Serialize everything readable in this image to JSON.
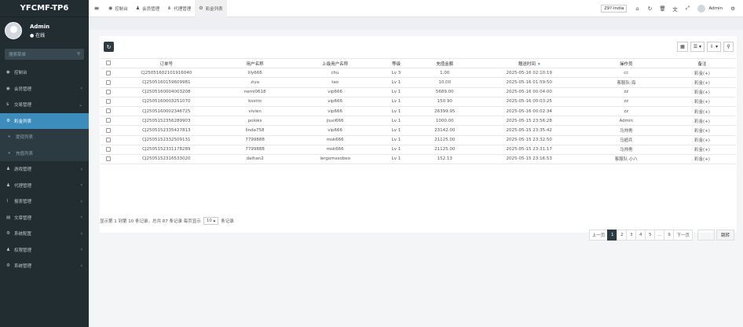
{
  "app": {
    "logo": "YFCMF-TP6"
  },
  "user": {
    "name": "Admin",
    "status": "● 在线"
  },
  "sidebar": {
    "search_placeholder": "搜索菜单",
    "items": [
      {
        "icon": "dashboard-icon",
        "glyph": "◉",
        "label": "控制台",
        "caret": false,
        "state": ""
      },
      {
        "icon": "users-icon",
        "glyph": "◉",
        "label": "会员管理",
        "caret": true,
        "state": ""
      },
      {
        "icon": "dollar-icon",
        "glyph": "$",
        "label": "交易管理",
        "caret": true,
        "state": "open"
      },
      {
        "icon": "gear-icon",
        "glyph": "⚙",
        "label": "彩金列表",
        "caret": false,
        "state": "active"
      },
      {
        "icon": "minus-icon",
        "glyph": "»",
        "label": "提现列表",
        "caret": false,
        "state": "sub"
      },
      {
        "icon": "minus-icon",
        "glyph": "«",
        "label": "充值列表",
        "caret": false,
        "state": "sub"
      },
      {
        "icon": "game-icon",
        "glyph": "♟",
        "label": "游戏管理",
        "caret": true,
        "state": ""
      },
      {
        "icon": "user-icon",
        "glyph": "♟",
        "label": "代理管理",
        "caret": true,
        "state": ""
      },
      {
        "icon": "chart-icon",
        "glyph": "⌇",
        "label": "报表管理",
        "caret": true,
        "state": ""
      },
      {
        "icon": "list-icon",
        "glyph": "▤",
        "label": "文章管理",
        "caret": true,
        "state": ""
      },
      {
        "icon": "settings-icon",
        "glyph": "⚙",
        "label": "系统配置",
        "caret": true,
        "state": ""
      },
      {
        "icon": "group-icon",
        "glyph": "♟",
        "label": "权限管理",
        "caret": true,
        "state": ""
      },
      {
        "icon": "cogs-icon",
        "glyph": "⚙",
        "label": "系统管理",
        "caret": true,
        "state": ""
      }
    ]
  },
  "topbar": {
    "tabs": [
      {
        "icon": "dashboard-icon",
        "glyph": "◉",
        "label": "控制台",
        "active": false
      },
      {
        "icon": "user-icon",
        "glyph": "♟",
        "label": "会员管理",
        "active": false
      },
      {
        "icon": "sitemap-icon",
        "glyph": "⋔",
        "label": "代理管理",
        "active": false
      },
      {
        "icon": "gear-icon",
        "glyph": "⚙",
        "label": "彩金列表",
        "active": true
      }
    ],
    "version": "29?-India",
    "user": "Admin"
  },
  "table": {
    "columns": [
      "",
      "订单号",
      "用户名称",
      "上级用户名称",
      "等级",
      "充值金额",
      "赠送时间",
      "操作员",
      "备注"
    ],
    "rows": [
      [
        "CJ25051602101916040",
        "lily666",
        "chu",
        "Lv 3",
        "1.00",
        "2025-05-16 02:10:19",
        "cc",
        "彩金(+)"
      ],
      [
        "CJ2505160159609981",
        "ziya",
        "tao",
        "Lv 1",
        "10.00",
        "2025-05-16 01:59:50",
        "客服队·海",
        "彩金(+)"
      ],
      [
        "CJ2505160004003208",
        "nemi0618",
        "vip666",
        "Lv 1",
        "5689.00",
        "2025-05-16 00:04:00",
        "zz",
        "彩金(+)"
      ],
      [
        "CJ2505160003251070",
        "kostro",
        "vip666",
        "Lv 1",
        "150.90",
        "2025-05-16 00:03:25",
        "zz",
        "彩金(+)"
      ],
      [
        "CJ2505160002346725",
        "vivien",
        "vip666",
        "Lv 1",
        "26399.95",
        "2025-05-16 00:02:34",
        "zz",
        "彩金(+)"
      ],
      [
        "CJ2505152356289903",
        "poloks",
        "jiuxi666",
        "Lv 1",
        "1000.00",
        "2025-05-15 23:56:28",
        "Admin",
        "彩金(+)"
      ],
      [
        "CJ2505152335427813",
        "linda758",
        "vip666",
        "Lv 1",
        "23142.00",
        "2025-05-15 23:35:42",
        "马帅男",
        "彩金(+)"
      ],
      [
        "CJ2505152332509131",
        "7799888",
        "msk666",
        "Lv 1",
        "21125.00",
        "2025-05-15 23:32:50",
        "马超兵",
        "彩金(+)"
      ],
      [
        "CJ2505152331178289",
        "7799888",
        "msk666",
        "Lv 1",
        "21125.00",
        "2025-05-15 23:31:17",
        "马帅男",
        "彩金(+)"
      ],
      [
        "CJ2505152316533020",
        "dalhan2",
        "lergomssobeo",
        "Lv 1",
        "152.13",
        "2025-05-15 23:16:53",
        "客服队·小八",
        "彩金(+)"
      ]
    ]
  },
  "footer": {
    "info_prefix": "显示第 1 到第 10 条记录，总共 87 条记录 每页显示",
    "page_size": "10 ▴",
    "info_suffix": "条记录"
  },
  "pager": {
    "prev": "上一页",
    "pages": [
      "1",
      "2",
      "3",
      "4",
      "5",
      "...",
      "9"
    ],
    "next": "下一页",
    "go": "跳转"
  }
}
